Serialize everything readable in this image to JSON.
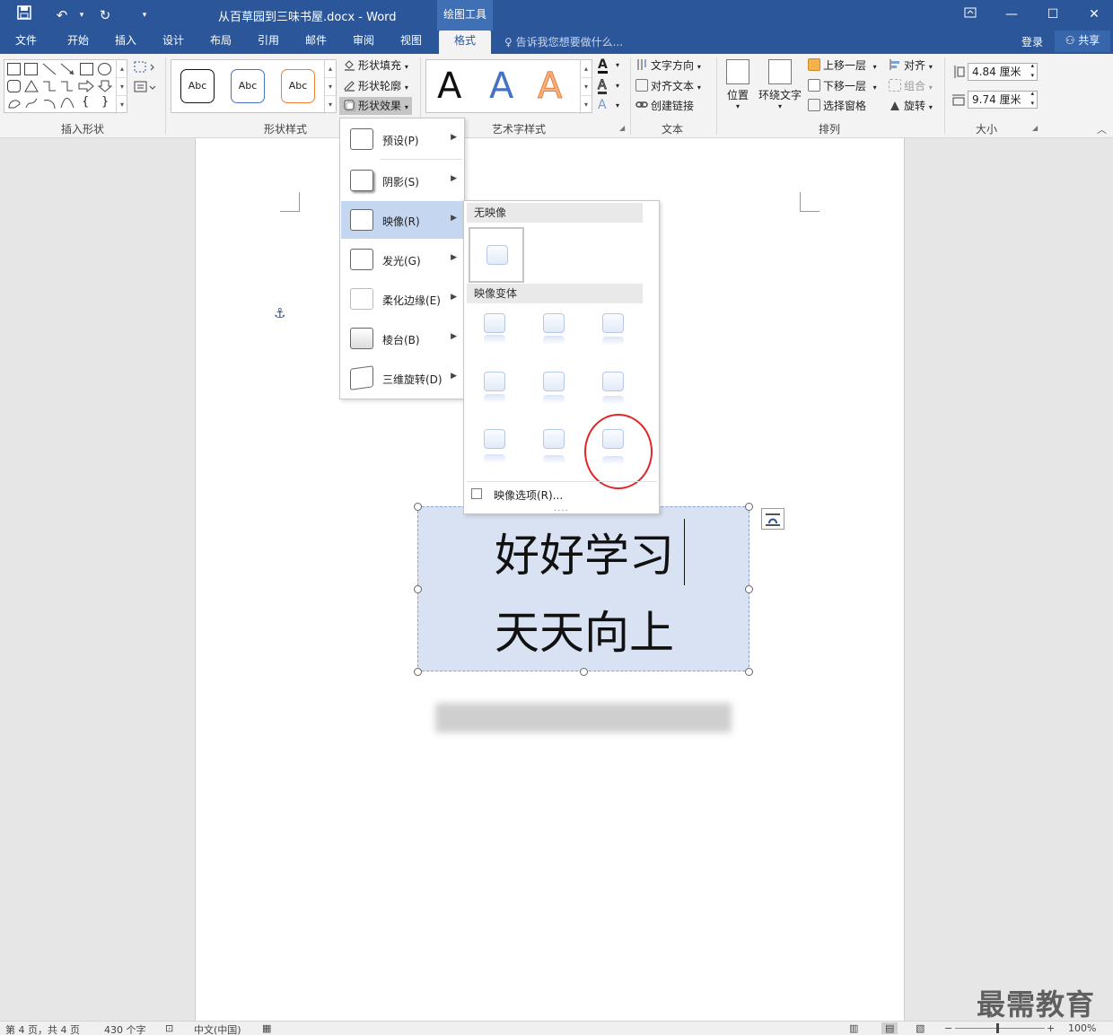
{
  "titlebar": {
    "save_icon": "save-icon",
    "undo_icon": "undo-icon",
    "redo_icon": "redo-icon",
    "title": "从百草园到三味书屋.docx - Word",
    "context_tab": "绘图工具"
  },
  "tabs": [
    {
      "label": "文件"
    },
    {
      "label": "开始"
    },
    {
      "label": "插入"
    },
    {
      "label": "设计"
    },
    {
      "label": "布局"
    },
    {
      "label": "引用"
    },
    {
      "label": "邮件"
    },
    {
      "label": "审阅"
    },
    {
      "label": "视图"
    },
    {
      "label": "格式"
    }
  ],
  "tellme": "告诉我您想要做什么...",
  "login": "登录",
  "share": "共享",
  "ribbon": {
    "groups": {
      "insert_shapes": "插入形状",
      "shape_styles": "形状样式",
      "wordart_styles": "艺术字样式",
      "text": "文本",
      "arrange": "排列",
      "size": "大小"
    },
    "style_abc": "Abc",
    "shape_fill": "形状填充",
    "shape_outline": "形状轮廓",
    "shape_effects": "形状效果",
    "wordart_letter": "A",
    "text_direction": "文字方向",
    "align_text": "对齐文本",
    "create_link": "创建链接",
    "position": "位置",
    "wrap_text": "环绕文字",
    "bring_forward": "上移一层",
    "send_backward": "下移一层",
    "selection_pane": "选择窗格",
    "align": "对齐",
    "group": "组合",
    "rotate": "旋转",
    "height": "4.84 厘米",
    "width": "9.74 厘米"
  },
  "effects_menu": [
    {
      "label": "预设(P)"
    },
    {
      "label": "阴影(S)"
    },
    {
      "label": "映像(R)"
    },
    {
      "label": "发光(G)"
    },
    {
      "label": "柔化边缘(E)"
    },
    {
      "label": "棱台(B)"
    },
    {
      "label": "三维旋转(D)"
    }
  ],
  "reflection_submenu": {
    "no_reflection": "无映像",
    "variations": "映像变体",
    "options": "映像选项(R)..."
  },
  "textbox": {
    "line1": "好好学习",
    "line2": "天天向上"
  },
  "status": {
    "page": "第 4 页，共 4 页",
    "words": "430 个字",
    "language": "中文(中国)",
    "zoom": "100%"
  },
  "watermark": "最需教育",
  "colors": {
    "accent": "#2b579a",
    "textbox_fill": "#d9e2f3",
    "highlight_circle": "#e0282a"
  }
}
